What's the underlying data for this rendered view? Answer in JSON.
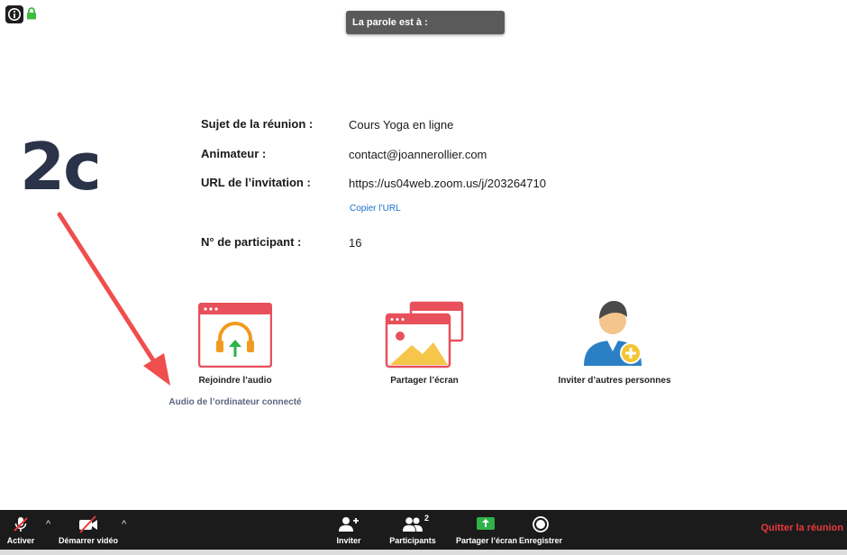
{
  "speaker_banner": {
    "text": "La parole est à :"
  },
  "step_label": "2c",
  "meeting": {
    "topic_label": "Sujet de la réunion :",
    "topic_value": "Cours Yoga en ligne",
    "host_label": "Animateur :",
    "host_value": "contact@joannerollier.com",
    "url_label": "URL de l’invitation :",
    "url_value": "https://us04web.zoom.us/j/203264710",
    "copy_url_label": "Copier l’URL",
    "participant_id_label": "N° de participant :",
    "participant_id_value": "16"
  },
  "actions": {
    "join_audio_label": "Rejoindre l’audio",
    "join_audio_sub": "Audio de l’ordinateur connecté",
    "share_screen_label": "Partager l’écran",
    "invite_label": "Inviter d’autres personnes"
  },
  "toolbar": {
    "unmute_label": "Activer",
    "start_video_label": "Démarrer vidéo",
    "invite_label": "Inviter",
    "participants_label": "Participants",
    "participants_count": "2",
    "share_label": "Partager l’écran",
    "record_label": "Enregistrer",
    "leave_label": "Quitter la réunion"
  },
  "colors": {
    "toolbar_bg": "#1b1b1b",
    "leave_red": "#e8383d",
    "tile_red": "#e8505b",
    "arrow_red": "#f04e4e",
    "link_blue": "#1a6fce",
    "share_green": "#2fb24a"
  }
}
